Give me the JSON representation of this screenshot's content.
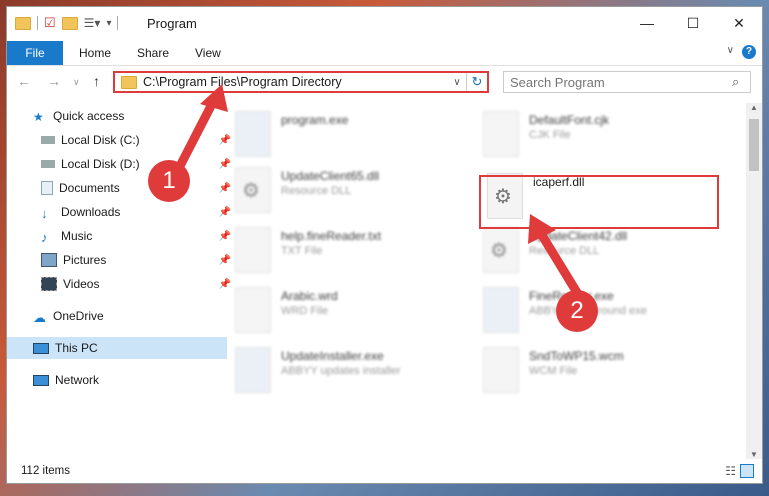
{
  "window": {
    "title": "Program"
  },
  "window_controls": {
    "minimize": "—",
    "maximize": "☐",
    "close": "✕"
  },
  "ribbon": {
    "file": "File",
    "home": "Home",
    "share": "Share",
    "view": "View"
  },
  "address": {
    "path": "C:\\Program Files\\Program Directory"
  },
  "search": {
    "placeholder": "Search Program"
  },
  "sidebar": {
    "items": [
      {
        "label": "Quick access"
      },
      {
        "label": "Local Disk (C:)"
      },
      {
        "label": "Local Disk (D:)"
      },
      {
        "label": "Documents"
      },
      {
        "label": "Downloads"
      },
      {
        "label": "Music"
      },
      {
        "label": "Pictures"
      },
      {
        "label": "Videos"
      },
      {
        "label": "OneDrive"
      },
      {
        "label": "This PC"
      },
      {
        "label": "Network"
      }
    ]
  },
  "files": [
    {
      "name": "program.exe",
      "sub": ""
    },
    {
      "name": "DefaultFont.cjk",
      "sub": "CJK File"
    },
    {
      "name": "UpdateClient65.dll",
      "sub": "Resource DLL"
    },
    {
      "name": "icaperf.dll",
      "sub": ""
    },
    {
      "name": "help.fineReader.txt",
      "sub": "TXT File"
    },
    {
      "name": "UpdateClient42.dll",
      "sub": "Resource DLL"
    },
    {
      "name": "Arabic.wrd",
      "sub": "WRD File"
    },
    {
      "name": "FineReader.exe",
      "sub": "ABBYY background exe"
    },
    {
      "name": "UpdateInstaller.exe",
      "sub": "ABBYY updates installer"
    },
    {
      "name": "SndToWP15.wcm",
      "sub": "WCM File"
    }
  ],
  "status": {
    "count": "112 items"
  },
  "annotations": {
    "badge1": "1",
    "badge2": "2"
  },
  "colors": {
    "accent": "#1979ca",
    "highlight": "#e03b3b",
    "selected": "#cce4f7"
  }
}
